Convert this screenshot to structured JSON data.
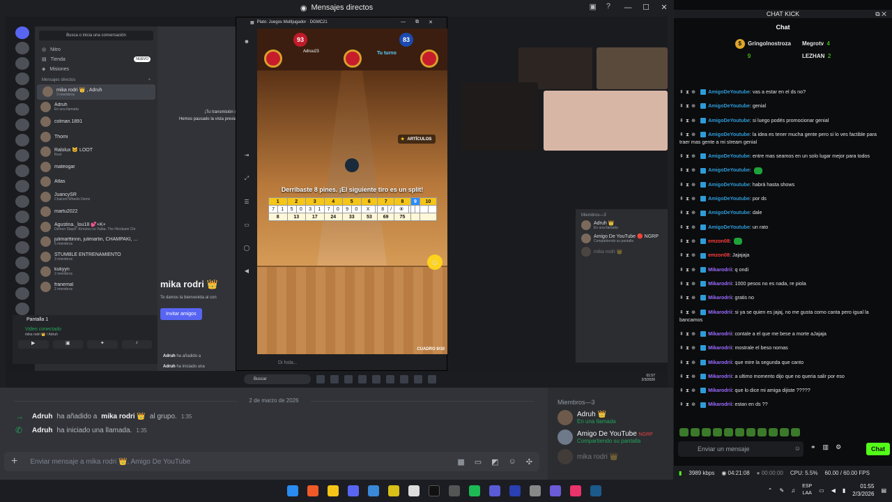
{
  "discord": {
    "window_title": "Mensajes directos",
    "date_divider": "2 de marzo de 2026",
    "system_messages": [
      {
        "user": "Adruh",
        "text": "ha añadido a",
        "target": "mika rodri 👑",
        "tail": "al grupo.",
        "time": "1:35"
      },
      {
        "user": "Adruh",
        "text": "ha iniciado una llamada.",
        "target": "",
        "tail": "",
        "time": "1:35"
      }
    ],
    "composer_placeholder": "Enviar mensaje a mika rodri 👑, Amigo De YouTube",
    "members": {
      "header": "Miembros—3",
      "list": [
        {
          "name": "Adruh 👑",
          "status": "En una llamada"
        },
        {
          "name": "Amigo De YouTube",
          "badge": "NGRP",
          "status": "Compartiendo su pantalla"
        },
        {
          "name": "mika rodri 👑",
          "status": ""
        }
      ]
    }
  },
  "inner": {
    "search": "Busca o inicia una conversación",
    "nav": [
      {
        "label": "Nitro",
        "badge": ""
      },
      {
        "label": "Tienda",
        "badge": "NUEVO"
      },
      {
        "label": "Misiones",
        "badge": ""
      }
    ],
    "dm_header": "Mensajes directos",
    "dm_plus": "+",
    "dms": [
      {
        "name": "mika rodri 👑 , Adruh",
        "sub": "3 miembros"
      },
      {
        "name": "Adruh",
        "sub": "En una llamada"
      },
      {
        "name": "colman.1891",
        "sub": ""
      },
      {
        "name": "Thomi",
        "sub": ""
      },
      {
        "name": "Ralolux 🐱 LOOT",
        "sub": "Rust"
      },
      {
        "name": "mateogar",
        "sub": ""
      },
      {
        "name": "Atlas",
        "sub": ""
      },
      {
        "name": "JuancySR",
        "sub": "Chained Wheels Demo"
      },
      {
        "name": "martu2022",
        "sub": ""
      },
      {
        "name": "Agustina._lou18 💕+K+",
        "sub": "Demon Slayer -Kimetsu no Yaiba- The Hinokami Chr"
      },
      {
        "name": "julimarttinnn, julimartin, CHAMPAKI, ...",
        "sub": "5 miembros"
      },
      {
        "name": "STUMBLE ENTRENAMIENTO",
        "sub": "3 miembros"
      },
      {
        "name": "kukyyn",
        "sub": "2 miembros"
      },
      {
        "name": "franemal",
        "sub": "2 miembros"
      }
    ],
    "voice_title": "Pantalla 1",
    "voice_connected": "Video conectado",
    "voice_user": "mika rodri 👑 / Adruh",
    "stream_notice": "¡Tu transmisión sig",
    "stream_notice2": "Hemos pausado la vista previa p",
    "channel_name": "mika rodri 👑",
    "welcome": "Te damos la bienvenida al con",
    "invite": "Invitar amigos",
    "msg1_user": "Adruh",
    "msg1_text": "ha añadido a",
    "msg2_user": "Adruh",
    "msg2_text": "ha iniciado una",
    "members_header": "Miembros—3",
    "members": [
      {
        "name": "Adruh 👑",
        "sub": "En una llamada"
      },
      {
        "name": "Amigo De YouTube 🔴 NGRP",
        "sub": "Compartiendo su pantalla"
      },
      {
        "name": "mika rodri 👑",
        "sub": ""
      }
    ],
    "taskbar_search": "Buscar",
    "taskbar_time": "01:57",
    "taskbar_date": "2/3/2026"
  },
  "game": {
    "window_title": "Plato: Juegos Multijugador · DGMC21",
    "player1_score": "93",
    "player1_name": "Adruu23",
    "player2_score": "83",
    "player2_label": "Tu turno",
    "articles": "ARTÍCULOS",
    "message": "Derribaste 8 pines. ¡El siguiente tiro es un split!",
    "frames": [
      "1",
      "2",
      "3",
      "4",
      "5",
      "6",
      "7",
      "8",
      "9",
      "10"
    ],
    "rolls": [
      "7",
      "1",
      "5",
      "0",
      "3",
      "1",
      "7",
      "0",
      "9",
      "0",
      "X",
      "",
      "8",
      "/",
      "⑧",
      "",
      " ",
      "",
      "",
      ""
    ],
    "totals": [
      "8",
      "13",
      "17",
      "24",
      "33",
      "53",
      "69",
      "75",
      "",
      ""
    ],
    "current_frame_index": 8,
    "frame_label": "CUADRO 9/10",
    "input_placeholder": "Di hola..."
  },
  "kick": {
    "header": "CHAT KICK",
    "tab": "Chat",
    "leaders": [
      {
        "name": "Gringolnostroza",
        "count": "9"
      },
      {
        "name": "Megrotv",
        "count": "4"
      },
      {
        "name": "LEZHAN",
        "count": "2"
      }
    ],
    "messages": [
      {
        "user": "AmigoDeYoutube",
        "cls": "u-a",
        "text": "vas a estar en el ds no?"
      },
      {
        "user": "AmigoDeYoutube",
        "cls": "u-a",
        "text": "genial"
      },
      {
        "user": "AmigoDeYoutube",
        "cls": "u-a",
        "text": "si luego podés promocionar genial"
      },
      {
        "user": "AmigoDeYoutube",
        "cls": "u-a",
        "text": "la idea es tener mucha gente pero si lo ves factible para traer mas gente a mi stream genial"
      },
      {
        "user": "AmigoDeYoutube",
        "cls": "u-a",
        "text": "entre mas seamos en un solo lugar mejor para todos"
      },
      {
        "user": "AmigoDeYoutube",
        "cls": "u-a",
        "text": "",
        "emote": true
      },
      {
        "user": "AmigoDeYoutube",
        "cls": "u-a",
        "text": "habrá hasta shows"
      },
      {
        "user": "AmigoDeYoutube",
        "cls": "u-a",
        "text": "por ds"
      },
      {
        "user": "AmigoDeYoutube",
        "cls": "u-a",
        "text": "dale"
      },
      {
        "user": "AmigoDeYoutube",
        "cls": "u-a",
        "text": "un rato"
      },
      {
        "user": "emzon08",
        "cls": "u-r",
        "text": "",
        "emote": true
      },
      {
        "user": "emzon08",
        "cls": "u-r",
        "text": "Jajajaja"
      },
      {
        "user": "Mikarodrii",
        "cls": "u-m",
        "text": "q ondi"
      },
      {
        "user": "Mikarodrii",
        "cls": "u-m",
        "text": "1000 pesos no es nada, re piola"
      },
      {
        "user": "Mikarodrii",
        "cls": "u-m",
        "text": "gratis no"
      },
      {
        "user": "Mikarodrii",
        "cls": "u-m",
        "text": "si ya se quien es jajaj, no me gusta como canta pero igual la bancamos"
      },
      {
        "user": "Mikarodrii",
        "cls": "u-m",
        "text": "contale a el que me bese a morte aJajaja"
      },
      {
        "user": "Mikarodrii",
        "cls": "u-m",
        "text": "mostrale el beso nomas"
      },
      {
        "user": "Mikarodrii",
        "cls": "u-m",
        "text": "que mire la segunda que canto"
      },
      {
        "user": "Mikarodrii",
        "cls": "u-m",
        "text": "a ultimo momento dijo que no queria salir por eso"
      },
      {
        "user": "Mikarodrii",
        "cls": "u-m",
        "text": "que lo dice mi amiga dijiste ?????"
      },
      {
        "user": "Mikarodrii",
        "cls": "u-m",
        "text": "estan en ds ??"
      }
    ],
    "input_placeholder": "Enviar un mensaje",
    "send": "Chat"
  },
  "status": {
    "bitrate": "3989 kbps",
    "live_time": "04:21:08",
    "rec_time": "00:00:00",
    "cpu": "CPU: 5.5%",
    "fps": "60.00 / 60.00 FPS"
  },
  "taskbar": {
    "lang1": "ESP",
    "lang2": "LAA",
    "time": "01:55",
    "date": "2/3/2026"
  },
  "colors": {
    "kick_green": "#53fc18",
    "discord_blurple": "#5865f2"
  }
}
